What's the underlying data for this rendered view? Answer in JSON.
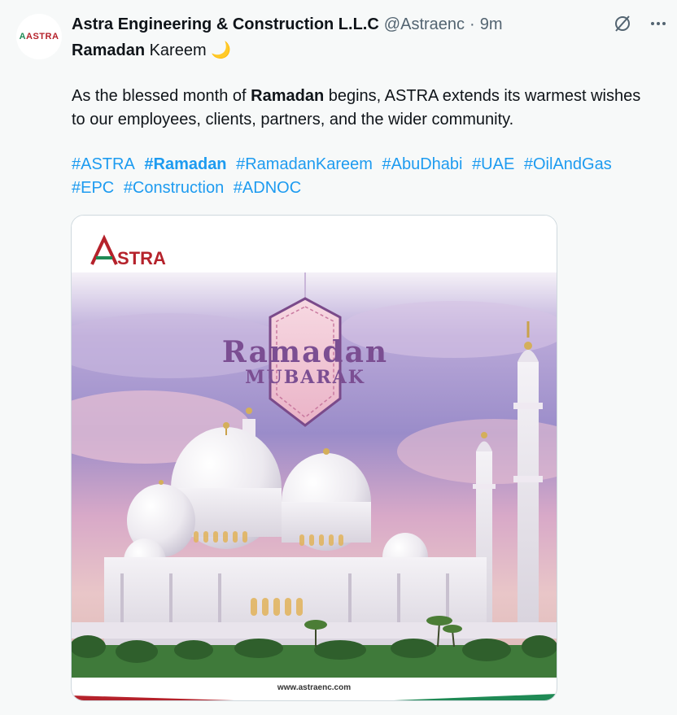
{
  "post": {
    "author": {
      "display_name": "Astra Engineering & Construction L.L.C",
      "handle": "@Astraenc",
      "separator": "·",
      "timestamp": "9m",
      "avatar_text": "ASTRA"
    },
    "title_bold": "Ramadan",
    "title_rest": " Kareem",
    "title_emoji": "🌙",
    "body_before": "As the blessed month of ",
    "body_bold": "Ramadan",
    "body_after": " begins, ASTRA extends its warmest wishes to our employees, clients, partners, and the wider community.",
    "hashtags": [
      "#ASTRA",
      "#Ramadan",
      "#RamadanKareem",
      "#AbuDhabi",
      "#UAE",
      "#OilAndGas",
      "#EPC",
      "#Construction",
      "#ADNOC"
    ],
    "media": {
      "logo_text": "STRA",
      "logo_letter": "A",
      "headline": "Ramadan",
      "subheadline": "MUBARAK",
      "website": "www.astraenc.com"
    }
  },
  "icons": {
    "grok": "slashed-circle-icon",
    "more": "more-dots-icon"
  },
  "colors": {
    "link": "#1d9bf0",
    "text": "#0f1419",
    "muted": "#536471",
    "brand_red": "#b5222b",
    "brand_green": "#1f8a55"
  }
}
